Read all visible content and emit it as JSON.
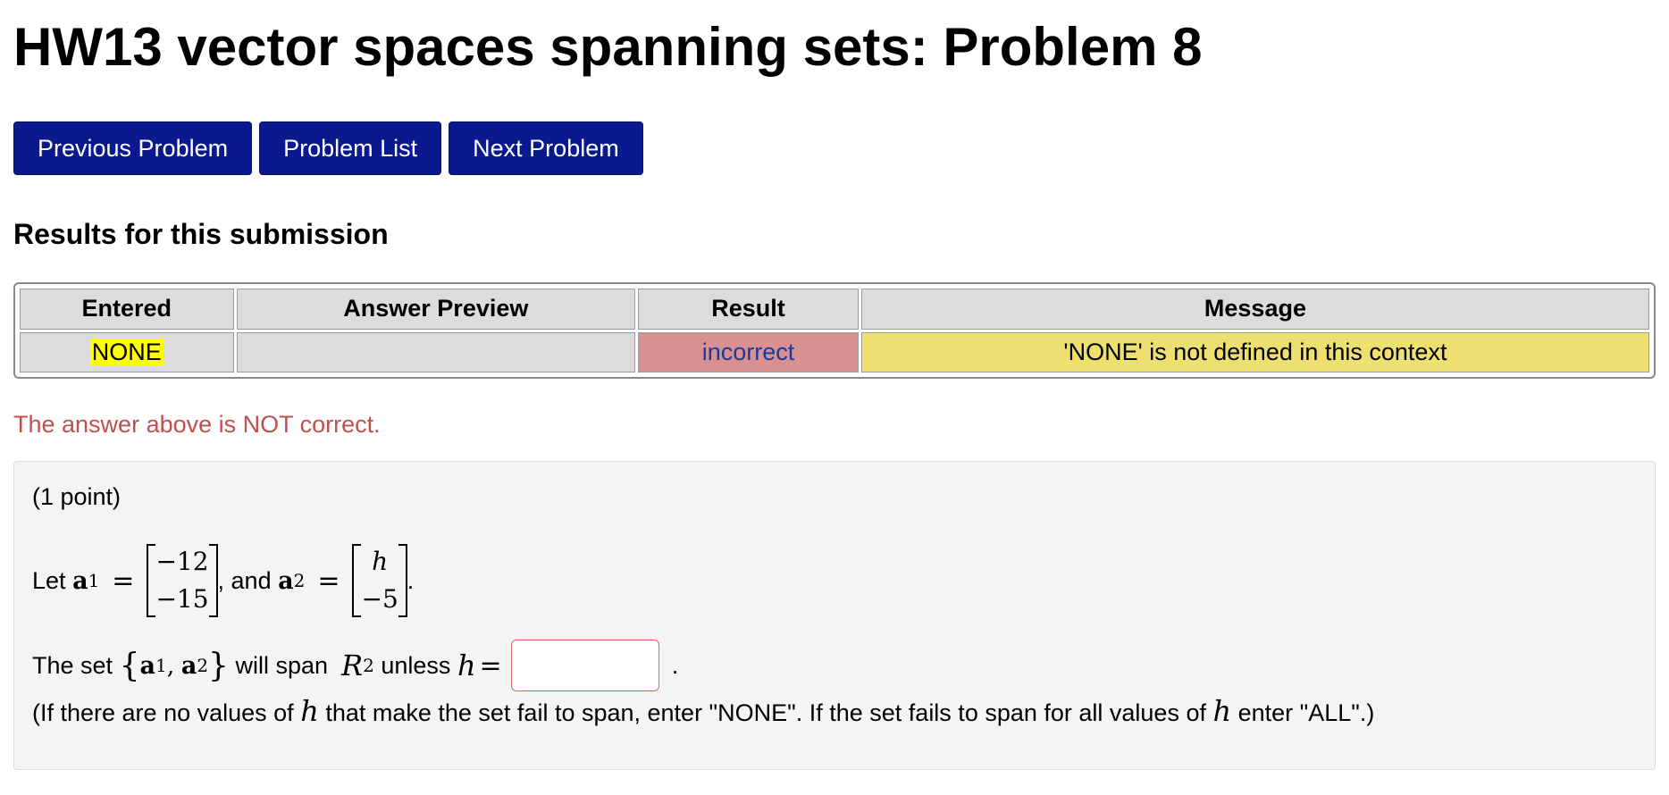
{
  "title": "HW13 vector spaces spanning sets: Problem 8",
  "nav": {
    "previous": "Previous Problem",
    "list": "Problem List",
    "next": "Next Problem"
  },
  "results": {
    "heading": "Results for this submission",
    "columns": [
      "Entered",
      "Answer Preview",
      "Result",
      "Message"
    ],
    "row": {
      "entered": "NONE",
      "preview": "",
      "result": "incorrect",
      "message": "'NONE' is not defined in this context"
    }
  },
  "status_message": "The answer above is NOT correct.",
  "problem": {
    "points": "(1 point)",
    "let_text": "Let",
    "a_symbol": "a",
    "a1_sub": "1",
    "a2_sub": "2",
    "eq": "=",
    "a1_values": [
      "−12",
      "−15"
    ],
    "and_text": ", and",
    "a2_values": [
      "h",
      "−5"
    ],
    "period": ".",
    "span_prefix": "The set",
    "set_open": "{",
    "set_close": "}",
    "comma": ",",
    "span_mid": "will span",
    "R": "R",
    "R_sup": "2",
    "unless": "unless",
    "h": "h",
    "answer_value": "",
    "after_input": ".",
    "hint_part1": "(If there are no values of",
    "hint_part2": "that make the set fail to span, enter \"NONE\". If the set fails to span for all values of",
    "hint_part3": "enter \"ALL\".)"
  }
}
